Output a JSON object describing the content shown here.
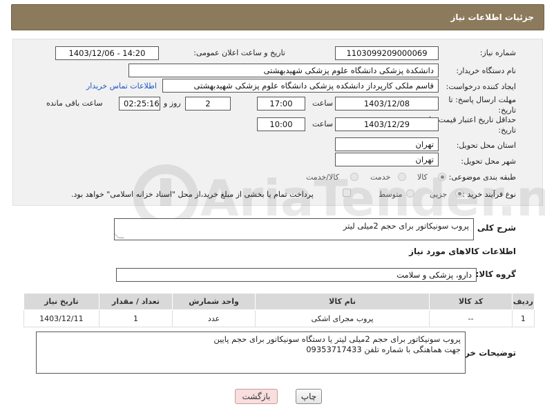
{
  "header": {
    "title": "جزئیات اطلاعات نیاز"
  },
  "form": {
    "need_number": {
      "label": "شماره نیاز:",
      "value": "1103099209000069"
    },
    "announce_datetime": {
      "label": "تاریخ و ساعت اعلان عمومی:",
      "value": "1403/12/06 - 14:20"
    },
    "buyer_org": {
      "label": "نام دستگاه خریدار:",
      "value": "دانشکدة پزشکی دانشگاه علوم پزشکی شهیدبهشتی"
    },
    "requester": {
      "label": "ایجاد کننده درخواست:",
      "value": "قاسم ملکی کارپرداز دانشکده پزشکی دانشگاه علوم پزشکی شهیدبهشتی",
      "contact_link": "اطلاعات تماس خریدار"
    },
    "reply_deadline": {
      "label_line1": "مهلت ارسال پاسخ: تا",
      "label_line2": "تاریخ:",
      "date": "1403/12/08",
      "time_label": "ساعت",
      "time": "17:00",
      "days": "2",
      "days_label": "روز و",
      "remaining": "02:25:16",
      "remaining_label": "ساعت باقی مانده"
    },
    "price_validity": {
      "label_line1": "حداقل تاریخ اعتبار قیمت: تا",
      "label_line2": "تاریخ:",
      "date": "1403/12/29",
      "time_label": "ساعت",
      "time": "10:00"
    },
    "province": {
      "label": "استان محل تحویل:",
      "value": "تهران"
    },
    "city": {
      "label": "شهر محل تحویل:",
      "value": "تهران"
    },
    "category": {
      "label": "طبقه بندی موضوعی:",
      "options": [
        "کالا",
        "خدمت",
        "کالا/خدمت"
      ],
      "selected": "کالا"
    },
    "purchase_process": {
      "label": "نوع فرآیند خرید :",
      "options": [
        "جزیی",
        "متوسط"
      ],
      "selected": "جزیی",
      "payment_note": "پرداخت تمام یا بخشی از مبلغ خرید،از محل \"اسناد خزانه اسلامی\" خواهد بود."
    }
  },
  "description": {
    "label": "شرح کلی نیاز:",
    "value": "پروب سونیکاتور برای حجم 2میلی لیتر"
  },
  "goods_info": {
    "title": "اطلاعات کالاهای مورد نیاز"
  },
  "goods_group": {
    "label": "گروه کالا:",
    "value": "دارو، پزشکی و سلامت"
  },
  "table": {
    "headers": [
      "ردیف",
      "کد کالا",
      "نام کالا",
      "واحد شمارش",
      "تعداد / مقدار",
      "تاریخ نیاز"
    ],
    "rows": [
      {
        "row": "1",
        "code": "--",
        "name": "پروب مجرای اشکی",
        "unit": "عدد",
        "qty": "1",
        "date": "1403/12/11"
      }
    ]
  },
  "buyer_notes": {
    "label": "توضیحات خریدار:",
    "line1": "پروب سونیکاتور برای حجم 2میلی لیتر یا دستگاه سونیکاتور برای حجم پایین",
    "line2": "جهت هماهنگی با شماره تلفن 09353717433"
  },
  "buttons": {
    "print": "چاپ",
    "back": "بازگشت"
  },
  "watermark": {
    "text": "AriaTender.neT"
  },
  "colors": {
    "header_bg": "#8c7a5c",
    "panel_bg": "#f1f1f1",
    "link": "#1a56c8",
    "back_button": "#f8dede"
  }
}
